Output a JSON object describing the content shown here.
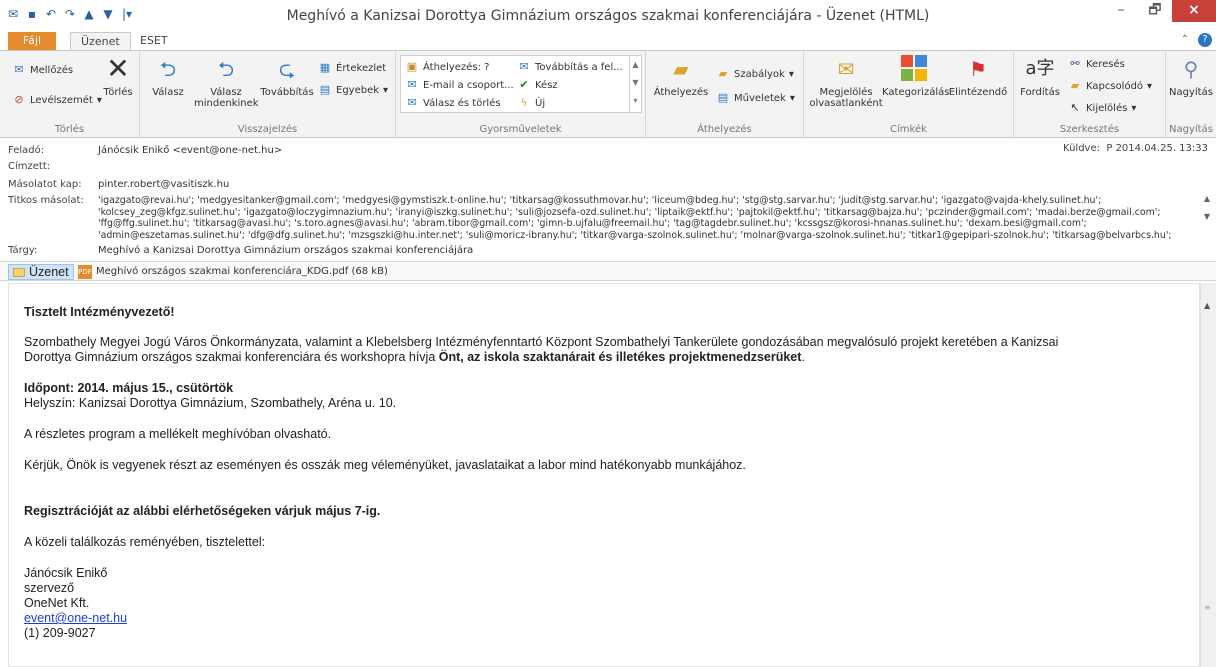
{
  "window": {
    "title": "Meghívó a Kanizsai Dorottya Gimnázium országos szakmai konferenciájára - Üzenet (HTML)",
    "minimize": "–",
    "maximize": "🗗",
    "close": "×"
  },
  "tabs": {
    "file": "Fájl",
    "message": "Üzenet",
    "eset": "ESET"
  },
  "ribbon": {
    "delete_group": {
      "label": "Törlés",
      "ignore": "Mellőzés",
      "junk": "Levélszemét",
      "delete": "Törlés"
    },
    "reply_group": {
      "label": "Visszajelzés",
      "reply": "Válasz",
      "reply_all": "Válasz mindenkinek",
      "forward": "Továbbítás",
      "meeting": "Értekezlet",
      "more": "Egyebek"
    },
    "quick_group": {
      "label": "Gyorsműveletek",
      "move_to": "Áthelyezés: ?",
      "to_manager": "Továbbítás a fel...",
      "team_email": "E-mail a csoport...",
      "done": "Kész",
      "reply_delete": "Válasz és törlés",
      "new": "Új"
    },
    "move_group": {
      "label": "Áthelyezés",
      "move": "Áthelyezés",
      "rules": "Szabályok",
      "actions": "Műveletek"
    },
    "tags_group": {
      "label": "Címkék",
      "mark_unread": "Megjelölés olvasatlanként",
      "categorize": "Kategorizálás",
      "followup": "Elintézendő"
    },
    "edit_group": {
      "label": "Szerkesztés",
      "translate": "Fordítás",
      "find": "Keresés",
      "related": "Kapcsolódó",
      "select": "Kijelölés"
    },
    "zoom_group": {
      "label": "Nagyítás",
      "zoom": "Nagyítás"
    }
  },
  "header": {
    "from_label": "Feladó:",
    "from": "Jánócsik Enikő <event@one-net.hu>",
    "to_label": "Címzett:",
    "cc_label": "Másolatot kap:",
    "cc": "pinter.robert@vasitiszk.hu",
    "bcc_label": "Titkos másolat:",
    "bcc_lines": [
      "'igazgato@revai.hu'; 'medgyesitanker@gmail.com'; 'medgyesi@gymstiszk.t-online.hu'; 'titkarsag@kossuthmovar.hu'; 'liceum@bdeg.hu'; 'stg@stg.sarvar.hu'; 'judit@stg.sarvar.hu'; 'igazgato@vajda-khely.sulinet.hu';",
      "'kolcsey_zeg@kfgz.sulinet.hu'; 'igazgato@loczygimnazium.hu'; 'iranyi@iszkg.sulinet.hu'; 'suli@jozsefa-ozd.sulinet.hu'; 'liptaik@ektf.hu'; 'pajtokil@ektf.hu'; 'titkarsag@bajza.hu'; 'pczinder@gmail.com'; 'madai.berze@gmail.com';",
      "'ffg@ffg.sulinet.hu'; 'titkarsag@avasi.hu'; 's.toro.agnes@avasi.hu'; 'abram.tibor@gmail.com'; 'gimn-b.ujfalu@freemail.hu'; 'tag@tagdebr.sulinet.hu'; 'kcssgsz@korosi-hnanas.sulinet.hu'; 'dexam.besi@gmail.com';",
      "'admin@eszetamas.sulinet.hu'; 'dfg@dfg.sulinet.hu'; 'mzsgszki@hu.inter.net'; 'suli@moricz-ibrany.hu'; 'titkar@varga-szolnok.sulinet.hu'; 'molnar@varga-szolnok.sulinet.hu'; 'titkar1@gepipari-szolnok.hu'; 'titkarsag@belvarbcs.hu';"
    ],
    "subject_label": "Tárgy:",
    "subject": "Meghívó a Kanizsai Dorottya Gimnázium országos szakmai konferenciájára",
    "sent_label": "Küldve:",
    "sent": "P 2014.04.25. 13:33"
  },
  "attachments": {
    "message_tab": "Üzenet",
    "pdf": "Meghívó országos szakmai konferenciára_KDG.pdf (68 kB)"
  },
  "body": {
    "greeting": "Tisztelt Intézményvezető!",
    "para1_line1": "Szombathely Megyei Jogú Város Önkormányzata, valamint a Klebelsberg Intézményfenntartó Központ Szombathelyi Tankerülete gondozásában megvalósuló projekt keretében a Kanizsai",
    "para1_line2_start": "Dorottya Gimnázium országos szakmai konferenciára és workshopra hívja ",
    "para1_line2_bold": "Önt, az iskola szaktanárait és illetékes projektmenedzserüket",
    "para1_line2_end": ".",
    "date_line": "Időpont: 2014. május 15., csütörtök",
    "venue_line": "Helyszín: Kanizsai Dorottya Gimnázium, Szombathely, Aréna u. 10.",
    "program_line": "A részletes program a mellékelt meghívóban olvasható.",
    "request_line": "Kérjük, Önök is vegyenek részt az eseményen és osszák meg véleményüket, javaslataikat a labor mind hatékonyabb munkájához.",
    "registration_line": "Regisztrációját az alábbi elérhetőségeken várjuk május 7-ig.",
    "closing_line": "A közeli találkozás reményében, tisztelettel:",
    "sig_name": "Jánócsik Enikő",
    "sig_role": "szervező",
    "sig_company": "OneNet Kft.",
    "sig_email": "event@one-net.hu",
    "sig_phone": "(1) 209-9027"
  }
}
